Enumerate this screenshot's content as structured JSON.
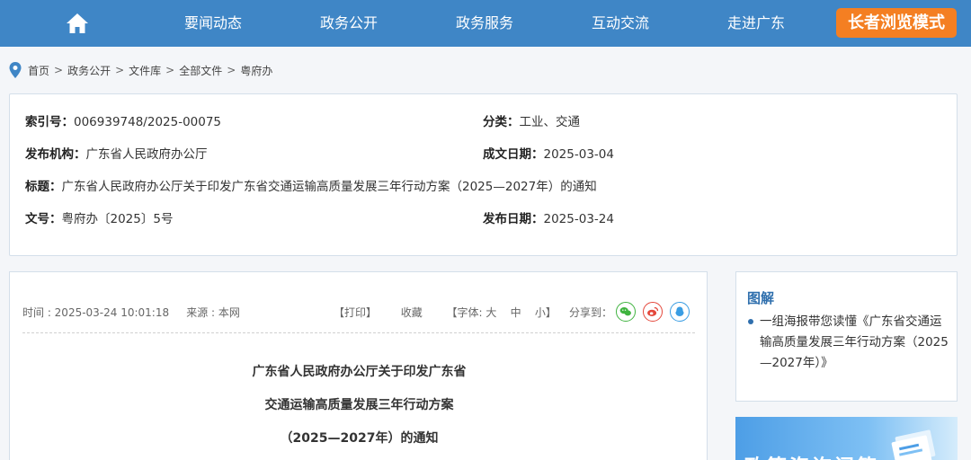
{
  "nav": {
    "items": [
      "要闻动态",
      "政务公开",
      "政务服务",
      "互动交流",
      "走进广东"
    ],
    "elder_mode": "长者浏览模式"
  },
  "breadcrumb": [
    "首页",
    "政务公开",
    "文件库",
    "全部文件",
    "粤府办"
  ],
  "doc_info": {
    "index_label": "索引号：",
    "index_value": "006939748/2025-00075",
    "category_label": "分类：",
    "category_value": "工业、交通",
    "issuer_label": "发布机构：",
    "issuer_value": "广东省人民政府办公厅",
    "written_label": "成文日期：",
    "written_value": "2025-03-04",
    "title_label": "标题：",
    "title_value": "广东省人民政府办公厅关于印发广东省交通运输高质量发展三年行动方案（2025—2027年）的通知",
    "docno_label": "文号：",
    "docno_value": "粤府办〔2025〕5号",
    "publish_label": "发布日期：",
    "publish_value": "2025-03-24"
  },
  "article": {
    "time": "时间 : 2025-03-24 10:01:18",
    "source": "来源 : 本网",
    "print": "【打印】",
    "favorite": "收藏",
    "font_label": "【字体:",
    "font_large": "大",
    "font_medium": "中",
    "font_small": "小",
    "font_close": "】",
    "share": "分享到：",
    "title_lines": [
      "广东省人民政府办公厅关于印发广东省",
      "交通运输高质量发展三年行动方案",
      "（2025—2027年）的通知"
    ]
  },
  "sidebar": {
    "title": "图解",
    "item": "一组海报带您读懂《广东省交通运输高质量发展三年行动方案（2025—2027年）》",
    "banner": "政策咨询问答"
  },
  "colors": {
    "nav_bg": "#3f86c6",
    "elder_btn": "#f47f22",
    "accent": "#2f6fad",
    "wechat": "#3fb33f",
    "weibo": "#e4473b",
    "qq": "#3a9de3"
  }
}
